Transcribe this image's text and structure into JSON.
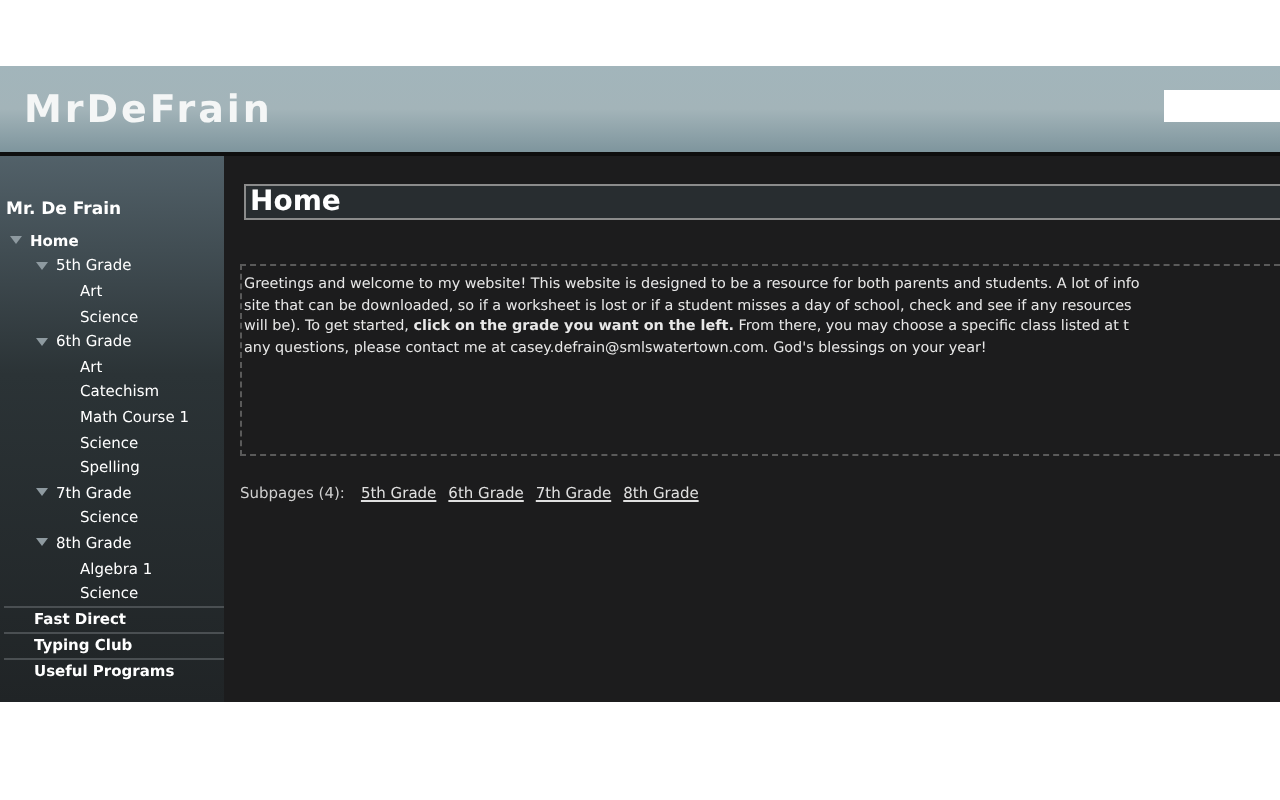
{
  "header": {
    "title": "MrDeFrain"
  },
  "sidebar": {
    "title": "Mr. De Frain",
    "tree": [
      {
        "label": "Home",
        "expanded": true,
        "children": [
          {
            "label": "5th Grade",
            "expanded": true,
            "children": [
              {
                "label": "Art"
              },
              {
                "label": "Science"
              }
            ]
          },
          {
            "label": "6th Grade",
            "expanded": true,
            "children": [
              {
                "label": "Art"
              },
              {
                "label": "Catechism"
              },
              {
                "label": "Math Course 1"
              },
              {
                "label": "Science"
              },
              {
                "label": "Spelling"
              }
            ]
          },
          {
            "label": "7th Grade",
            "expanded": true,
            "children": [
              {
                "label": "Science"
              }
            ]
          },
          {
            "label": "8th Grade",
            "expanded": true,
            "children": [
              {
                "label": "Algebra 1"
              },
              {
                "label": "Science"
              }
            ]
          }
        ]
      }
    ],
    "links": [
      "Fast Direct",
      "Typing Club",
      "Useful Programs"
    ]
  },
  "content": {
    "title": "Home",
    "paragraph_lines": [
      "Greetings and welcome to my website! This website is designed to be a resource for both parents and students. A lot of info",
      "site that can be downloaded, so if a worksheet is lost or if a student misses a day of school, check and see if any resources",
      "will be). To get started, **click on the grade you want on the left.** From there, you may choose a specific class listed at t",
      "any questions, please contact me at casey.defrain@smlswatertown.com. God's blessings on your year!"
    ],
    "subpages_label": "Subpages (4):",
    "subpages": [
      "5th Grade",
      "6th Grade",
      "7th Grade",
      "8th Grade"
    ]
  }
}
